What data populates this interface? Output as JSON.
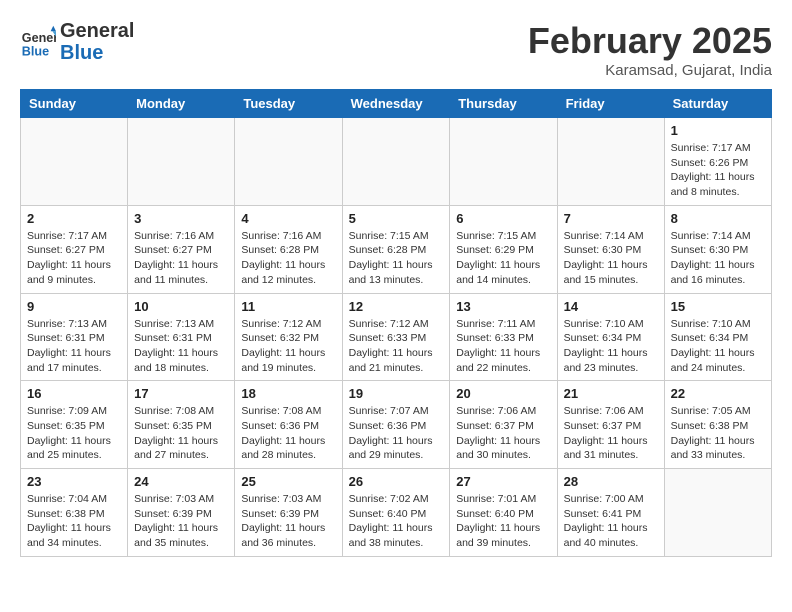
{
  "header": {
    "logo_line1": "General",
    "logo_line2": "Blue",
    "month_year": "February 2025",
    "location": "Karamsad, Gujarat, India"
  },
  "weekdays": [
    "Sunday",
    "Monday",
    "Tuesday",
    "Wednesday",
    "Thursday",
    "Friday",
    "Saturday"
  ],
  "weeks": [
    [
      {
        "day": "",
        "info": ""
      },
      {
        "day": "",
        "info": ""
      },
      {
        "day": "",
        "info": ""
      },
      {
        "day": "",
        "info": ""
      },
      {
        "day": "",
        "info": ""
      },
      {
        "day": "",
        "info": ""
      },
      {
        "day": "1",
        "info": "Sunrise: 7:17 AM\nSunset: 6:26 PM\nDaylight: 11 hours and 8 minutes."
      }
    ],
    [
      {
        "day": "2",
        "info": "Sunrise: 7:17 AM\nSunset: 6:27 PM\nDaylight: 11 hours and 9 minutes."
      },
      {
        "day": "3",
        "info": "Sunrise: 7:16 AM\nSunset: 6:27 PM\nDaylight: 11 hours and 11 minutes."
      },
      {
        "day": "4",
        "info": "Sunrise: 7:16 AM\nSunset: 6:28 PM\nDaylight: 11 hours and 12 minutes."
      },
      {
        "day": "5",
        "info": "Sunrise: 7:15 AM\nSunset: 6:28 PM\nDaylight: 11 hours and 13 minutes."
      },
      {
        "day": "6",
        "info": "Sunrise: 7:15 AM\nSunset: 6:29 PM\nDaylight: 11 hours and 14 minutes."
      },
      {
        "day": "7",
        "info": "Sunrise: 7:14 AM\nSunset: 6:30 PM\nDaylight: 11 hours and 15 minutes."
      },
      {
        "day": "8",
        "info": "Sunrise: 7:14 AM\nSunset: 6:30 PM\nDaylight: 11 hours and 16 minutes."
      }
    ],
    [
      {
        "day": "9",
        "info": "Sunrise: 7:13 AM\nSunset: 6:31 PM\nDaylight: 11 hours and 17 minutes."
      },
      {
        "day": "10",
        "info": "Sunrise: 7:13 AM\nSunset: 6:31 PM\nDaylight: 11 hours and 18 minutes."
      },
      {
        "day": "11",
        "info": "Sunrise: 7:12 AM\nSunset: 6:32 PM\nDaylight: 11 hours and 19 minutes."
      },
      {
        "day": "12",
        "info": "Sunrise: 7:12 AM\nSunset: 6:33 PM\nDaylight: 11 hours and 21 minutes."
      },
      {
        "day": "13",
        "info": "Sunrise: 7:11 AM\nSunset: 6:33 PM\nDaylight: 11 hours and 22 minutes."
      },
      {
        "day": "14",
        "info": "Sunrise: 7:10 AM\nSunset: 6:34 PM\nDaylight: 11 hours and 23 minutes."
      },
      {
        "day": "15",
        "info": "Sunrise: 7:10 AM\nSunset: 6:34 PM\nDaylight: 11 hours and 24 minutes."
      }
    ],
    [
      {
        "day": "16",
        "info": "Sunrise: 7:09 AM\nSunset: 6:35 PM\nDaylight: 11 hours and 25 minutes."
      },
      {
        "day": "17",
        "info": "Sunrise: 7:08 AM\nSunset: 6:35 PM\nDaylight: 11 hours and 27 minutes."
      },
      {
        "day": "18",
        "info": "Sunrise: 7:08 AM\nSunset: 6:36 PM\nDaylight: 11 hours and 28 minutes."
      },
      {
        "day": "19",
        "info": "Sunrise: 7:07 AM\nSunset: 6:36 PM\nDaylight: 11 hours and 29 minutes."
      },
      {
        "day": "20",
        "info": "Sunrise: 7:06 AM\nSunset: 6:37 PM\nDaylight: 11 hours and 30 minutes."
      },
      {
        "day": "21",
        "info": "Sunrise: 7:06 AM\nSunset: 6:37 PM\nDaylight: 11 hours and 31 minutes."
      },
      {
        "day": "22",
        "info": "Sunrise: 7:05 AM\nSunset: 6:38 PM\nDaylight: 11 hours and 33 minutes."
      }
    ],
    [
      {
        "day": "23",
        "info": "Sunrise: 7:04 AM\nSunset: 6:38 PM\nDaylight: 11 hours and 34 minutes."
      },
      {
        "day": "24",
        "info": "Sunrise: 7:03 AM\nSunset: 6:39 PM\nDaylight: 11 hours and 35 minutes."
      },
      {
        "day": "25",
        "info": "Sunrise: 7:03 AM\nSunset: 6:39 PM\nDaylight: 11 hours and 36 minutes."
      },
      {
        "day": "26",
        "info": "Sunrise: 7:02 AM\nSunset: 6:40 PM\nDaylight: 11 hours and 38 minutes."
      },
      {
        "day": "27",
        "info": "Sunrise: 7:01 AM\nSunset: 6:40 PM\nDaylight: 11 hours and 39 minutes."
      },
      {
        "day": "28",
        "info": "Sunrise: 7:00 AM\nSunset: 6:41 PM\nDaylight: 11 hours and 40 minutes."
      },
      {
        "day": "",
        "info": ""
      }
    ]
  ]
}
